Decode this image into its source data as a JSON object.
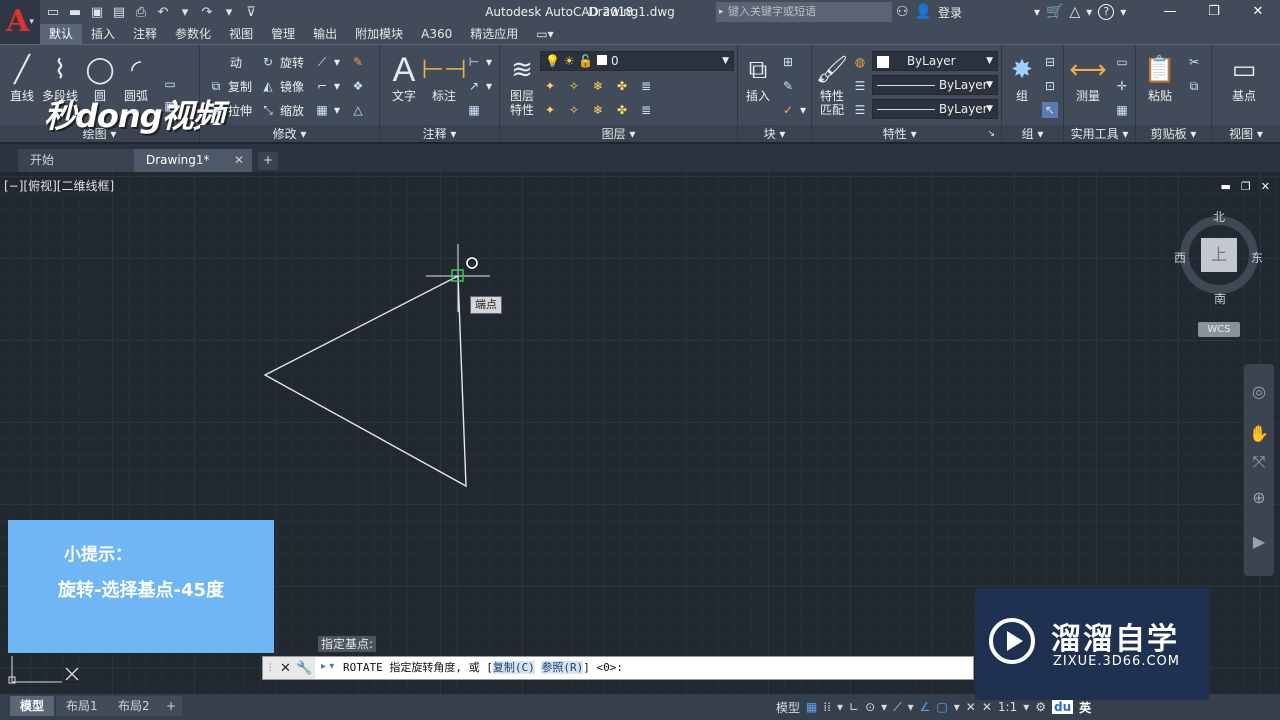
{
  "titlebar": {
    "app_name": "Autodesk AutoCAD 2018",
    "document": "Drawing1.dwg",
    "search_placeholder": "键入关键字或短语",
    "login": "登录",
    "help": "?"
  },
  "ribbon_tabs": [
    "默认",
    "插入",
    "注释",
    "参数化",
    "视图",
    "管理",
    "输出",
    "附加模块",
    "A360",
    "精选应用"
  ],
  "panels": {
    "draw": {
      "title": "绘图",
      "line": "直线",
      "polyline": "多段线",
      "circle": "圆",
      "arc": "圆弧"
    },
    "modify": {
      "title": "修改",
      "move": "动",
      "rotate": "旋转",
      "copy": "复制",
      "mirror": "镜像",
      "stretch": "拉伸",
      "scale": "缩放"
    },
    "annotation": {
      "title": "注释",
      "text": "文字",
      "dimension": "标注"
    },
    "layers": {
      "title": "图层",
      "layer_props": "图层\n特性",
      "current_layer": "0"
    },
    "block": {
      "title": "块",
      "insert": "插入"
    },
    "properties": {
      "title": "特性",
      "match": "特性\n匹配",
      "color": "ByLayer",
      "linetype": "ByLayer",
      "lineweight": "ByLayer"
    },
    "groups": {
      "title": "组",
      "group": "组"
    },
    "utilities": {
      "title": "实用工具",
      "measure": "测量"
    },
    "clipboard": {
      "title": "剪贴板",
      "paste": "粘贴"
    },
    "view": {
      "title": "视图",
      "base": "基点"
    }
  },
  "logo": "秒dong视频",
  "doc_tabs": {
    "start": "开始",
    "drawing": "Drawing1*"
  },
  "viewport_label": "[−][俯视][二维线框]",
  "viewcube": {
    "top": "上",
    "north": "北",
    "south": "南",
    "east": "东",
    "west": "西",
    "wcs": "WCS"
  },
  "tip": {
    "title": "小提示：",
    "body": "旋转-选择基点-45度"
  },
  "cursor_tooltip": "端点",
  "prompt_label": "指定基点:",
  "command": {
    "cmd": "ROTATE 指定旋转角度, 或 [",
    "opt1": "复制(C)",
    "opt2": "参照(R)",
    "tail": "] <0>:"
  },
  "layout_tabs": [
    "模型",
    "布局1",
    "布局2"
  ],
  "status": {
    "model": "模型",
    "scale": "1:1",
    "ime": "英"
  },
  "zixue": {
    "name": "溜溜自学",
    "url": "ZIXUE.3D66.COM"
  }
}
